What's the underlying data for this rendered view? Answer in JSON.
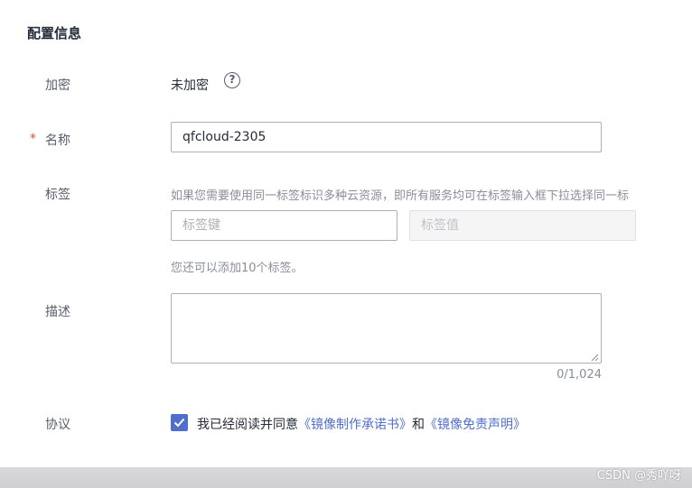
{
  "section": {
    "title": "配置信息"
  },
  "fields": {
    "encryption": {
      "label": "加密",
      "value": "未加密",
      "help_icon": "?"
    },
    "name": {
      "required_mark": "*",
      "label": "名称",
      "value": "qfcloud-2305"
    },
    "tags": {
      "label": "标签",
      "hint": "如果您需要使用同一标签标识多种云资源，即所有服务均可在标签输入框下拉选择同一标",
      "key_placeholder": "标签键",
      "value_placeholder": "标签值",
      "remaining": "您还可以添加10个标签。"
    },
    "description": {
      "label": "描述",
      "value": "",
      "counter": "0/1,024"
    },
    "agreement": {
      "label": "协议",
      "checked": true,
      "text_before": "我已经阅读并同意",
      "link1": "《镜像制作承诺书》",
      "text_middle": "和",
      "link2": "《镜像免责声明》"
    }
  },
  "watermark": "CSDN @秀吖呀",
  "colors": {
    "accent": "#526ecc",
    "required": "#e84e2e"
  }
}
